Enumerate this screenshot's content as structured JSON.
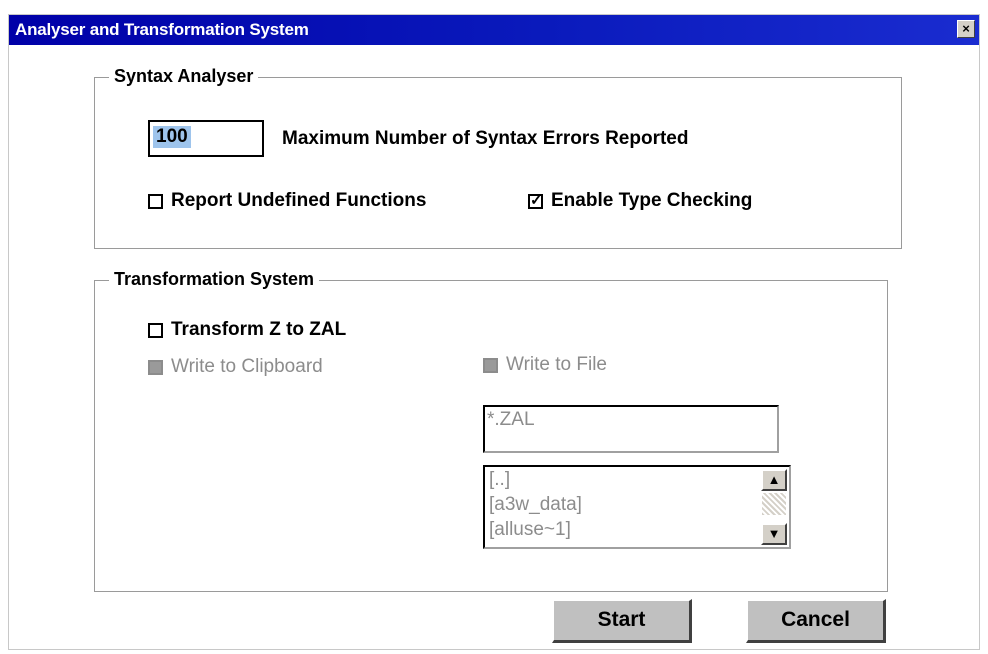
{
  "window": {
    "title": "Analyser and Transformation System",
    "close_glyph": "×"
  },
  "syntax": {
    "legend": "Syntax Analyser",
    "max_errors_value": "100",
    "max_errors_label": "Maximum Number of Syntax Errors Reported",
    "report_undefined_label": "Report Undefined Functions",
    "report_undefined_checked": false,
    "type_checking_label": "Enable Type Checking",
    "type_checking_checked": true
  },
  "transform": {
    "legend": "Transformation System",
    "transform_z_label": "Transform Z to ZAL",
    "transform_z_checked": false,
    "write_clipboard_label": "Write to Clipboard",
    "write_file_label": "Write to File",
    "file_filter_value": "*.ZAL",
    "file_list": [
      "[..]",
      "[a3w_data]",
      "[alluse~1]"
    ]
  },
  "buttons": {
    "start_label": "Start",
    "cancel_label": "Cancel"
  },
  "icons": {
    "close": "close-icon",
    "check": "check-icon",
    "scroll_up": "scroll-up-arrow-icon",
    "scroll_down": "scroll-down-arrow-icon"
  },
  "colors": {
    "titlebar": "#0000a8",
    "selection": "#9ec4ec",
    "disabled_text": "#8c8c8c",
    "button_face": "#c0c0c0"
  }
}
